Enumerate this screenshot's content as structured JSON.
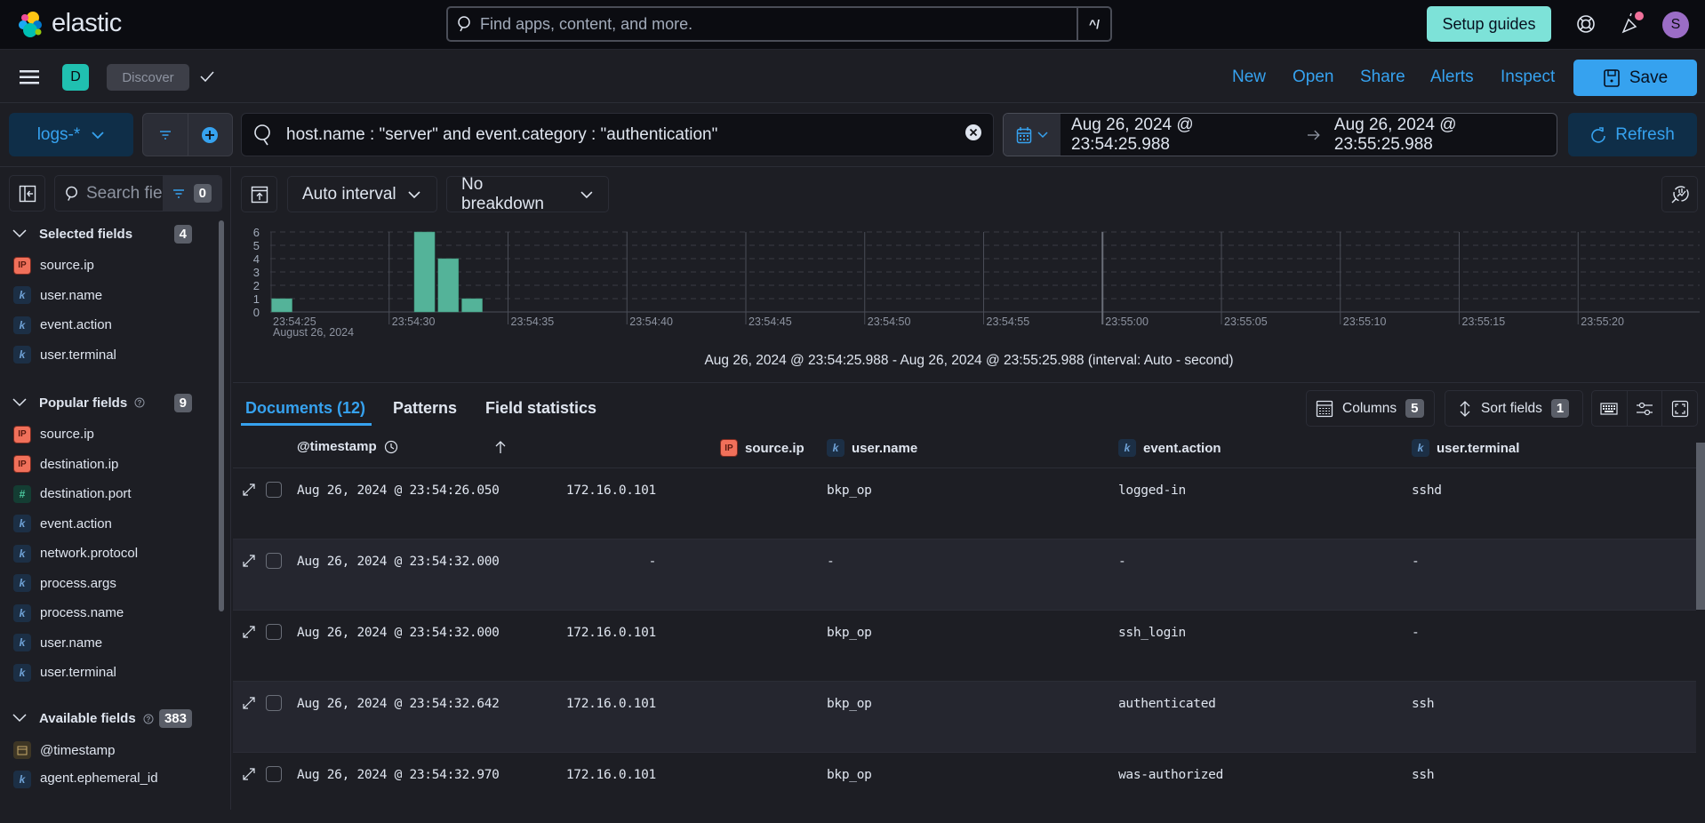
{
  "header": {
    "brand": "elastic",
    "search_placeholder": "Find apps, content, and more.",
    "search_shortcut": "^/",
    "setup_guides": "Setup guides",
    "avatar_initial": "S"
  },
  "appbar": {
    "space_initial": "D",
    "breadcrumb": "Discover",
    "links": [
      "New",
      "Open",
      "Share",
      "Alerts",
      "Inspect"
    ],
    "save_label": "Save"
  },
  "querybar": {
    "data_view": "logs-*",
    "query": "host.name : \"server\" and event.category : \"authentication\"",
    "time_start": "Aug 26, 2024 @ 23:54:25.988",
    "time_end": "Aug 26, 2024 @ 23:55:25.988",
    "refresh_label": "Refresh"
  },
  "sidebar": {
    "search_placeholder": "Search field names",
    "filter_count": "0",
    "sections": [
      {
        "title": "Selected fields",
        "count": "4",
        "help": false,
        "fields": [
          {
            "name": "source.ip",
            "type": "ip"
          },
          {
            "name": "user.name",
            "type": "keyword"
          },
          {
            "name": "event.action",
            "type": "keyword"
          },
          {
            "name": "user.terminal",
            "type": "keyword"
          }
        ]
      },
      {
        "title": "Popular fields",
        "count": "9",
        "help": true,
        "fields": [
          {
            "name": "source.ip",
            "type": "ip"
          },
          {
            "name": "destination.ip",
            "type": "ip"
          },
          {
            "name": "destination.port",
            "type": "number"
          },
          {
            "name": "event.action",
            "type": "keyword"
          },
          {
            "name": "network.protocol",
            "type": "keyword"
          },
          {
            "name": "process.args",
            "type": "keyword"
          },
          {
            "name": "process.name",
            "type": "keyword"
          },
          {
            "name": "user.name",
            "type": "keyword"
          },
          {
            "name": "user.terminal",
            "type": "keyword"
          }
        ]
      },
      {
        "title": "Available fields",
        "count": "383",
        "help": true,
        "fields": [
          {
            "name": "@timestamp",
            "type": "date"
          },
          {
            "name": "agent.ephemeral_id",
            "type": "keyword"
          }
        ]
      }
    ]
  },
  "histogram_controls": {
    "interval": "Auto interval",
    "breakdown": "No breakdown"
  },
  "chart_data": {
    "type": "bar",
    "title": "",
    "xlabel": "",
    "ylabel": "",
    "x_start": "23:54:25",
    "x_end": "23:55:25",
    "bucket": "1 second",
    "bars": [
      {
        "time": "23:54:25",
        "count": 1
      },
      {
        "time": "23:54:31",
        "count": 6
      },
      {
        "time": "23:54:32",
        "count": 4
      },
      {
        "time": "23:54:33",
        "count": 1
      }
    ],
    "x_tick_labels": [
      "23:54:25",
      "23:54:30",
      "23:54:35",
      "23:54:40",
      "23:54:45",
      "23:54:50",
      "23:54:55",
      "23:55:00",
      "23:55:05",
      "23:55:10",
      "23:55:15",
      "23:55:20"
    ],
    "x_sub_label": "August 26, 2024",
    "y_ticks": [
      0,
      1,
      2,
      3,
      4,
      5,
      6
    ],
    "ylim": [
      0,
      6
    ],
    "grid": true,
    "color": "#54b399"
  },
  "range_text": "Aug 26, 2024 @ 23:54:25.988 - Aug 26, 2024 @ 23:55:25.988 (interval: Auto - second)",
  "tabs": [
    {
      "label": "Documents (12)",
      "active": true
    },
    {
      "label": "Patterns",
      "active": false
    },
    {
      "label": "Field statistics",
      "active": false
    }
  ],
  "table_toolbar": {
    "columns_label": "Columns",
    "columns_count": "5",
    "sort_label": "Sort fields",
    "sort_count": "1"
  },
  "table": {
    "columns": [
      {
        "name": "@timestamp",
        "type": "date"
      },
      {
        "name": "source.ip",
        "type": "ip"
      },
      {
        "name": "user.name",
        "type": "keyword"
      },
      {
        "name": "event.action",
        "type": "keyword"
      },
      {
        "name": "user.terminal",
        "type": "keyword"
      }
    ],
    "rows": [
      {
        "timestamp": "Aug 26, 2024 @ 23:54:26.050",
        "source_ip": "172.16.0.101",
        "user_name": "bkp_op",
        "event_action": "logged-in",
        "user_terminal": "sshd"
      },
      {
        "timestamp": "Aug 26, 2024 @ 23:54:32.000",
        "source_ip": "-",
        "user_name": "-",
        "event_action": "-",
        "user_terminal": "-"
      },
      {
        "timestamp": "Aug 26, 2024 @ 23:54:32.000",
        "source_ip": "172.16.0.101",
        "user_name": "bkp_op",
        "event_action": "ssh_login",
        "user_terminal": "-"
      },
      {
        "timestamp": "Aug 26, 2024 @ 23:54:32.642",
        "source_ip": "172.16.0.101",
        "user_name": "bkp_op",
        "event_action": "authenticated",
        "user_terminal": "ssh"
      },
      {
        "timestamp": "Aug 26, 2024 @ 23:54:32.970",
        "source_ip": "172.16.0.101",
        "user_name": "bkp_op",
        "event_action": "was-authorized",
        "user_terminal": "ssh"
      }
    ]
  }
}
